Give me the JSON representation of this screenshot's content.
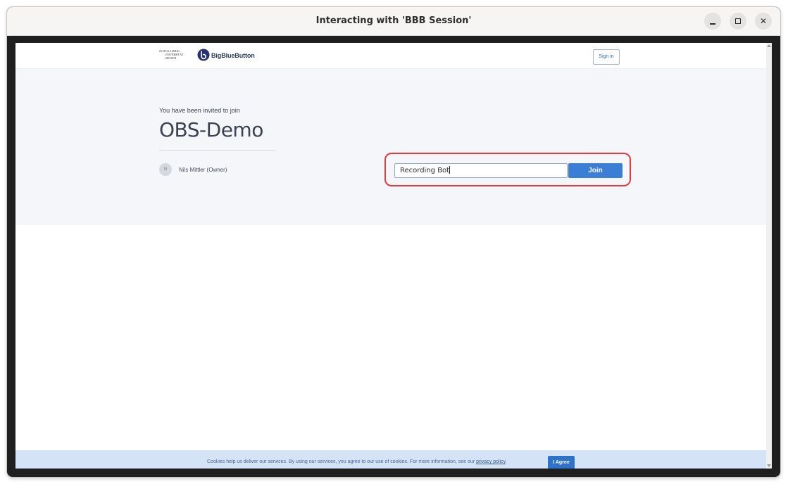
{
  "window": {
    "title": "Interacting with 'BBB Session'",
    "controls": {
      "minimize": "minimize",
      "maximize": "maximize",
      "close": "✕"
    }
  },
  "header": {
    "university_logo_lines": [
      "JUSTUS-LIEBIG-",
      "UNIVERSITÄT",
      "GIESSEN"
    ],
    "brand": "BigBlueButton",
    "sign_in_label": "Sign in"
  },
  "room": {
    "invite_text": "You have been invited to join",
    "name": "OBS-Demo",
    "owner_initial": "N",
    "owner_name": "Nils Mittler (Owner)"
  },
  "join_form": {
    "name_value": "Recording Bot",
    "join_label": "Join"
  },
  "cookie_banner": {
    "text": "Cookies help us deliver our services. By using our services, you agree to our use of cookies. For more information, see our ",
    "link_text": "privacy policy",
    "trailing": ".",
    "agree_label": "I Agree"
  },
  "colors": {
    "accent": "#3b7ed6",
    "highlight": "#e8383d",
    "hero_bg": "#f5f6fa",
    "cookie_bg": "#d4e3f6"
  }
}
